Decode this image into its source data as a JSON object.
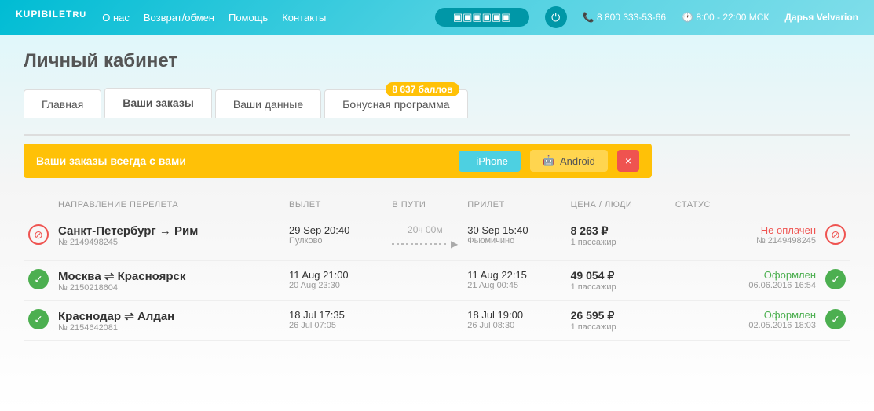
{
  "header": {
    "logo": "KUPIBILET",
    "logo_ru": "RU",
    "nav": [
      "О нас",
      "Возврат/обмен",
      "Помощь",
      "Контакты"
    ],
    "search_placeholder": "Поиск",
    "phone": "8 800 333-53-66",
    "hours": "8:00 - 22:00 МСК",
    "user": "Дарья Velvarion"
  },
  "page": {
    "title": "Личный кабинет"
  },
  "tabs": [
    {
      "label": "Главная",
      "active": false
    },
    {
      "label": "Ваши заказы",
      "active": true
    },
    {
      "label": "Ваши данные",
      "active": false
    },
    {
      "label": "Бонусная программа",
      "active": false
    }
  ],
  "bonus_badge": "8 637  баллов",
  "app_banner": {
    "text": "Ваши заказы всегда с вами",
    "iphone_label": "iPhone",
    "android_label": "Android",
    "close": "×"
  },
  "table": {
    "headers": [
      "НАПРАВЛЕНИЕ ПЕРЕЛЕТА",
      "ВЫЛЕТ",
      "В ПУТИ",
      "ПРИЛЕТ",
      "ЦЕНА / ЛЮДИ",
      "СТАТУС"
    ],
    "rows": [
      {
        "status_icon": "red",
        "route": "Санкт-Петербург → Рим",
        "order_num": "№ 2149498245",
        "depart_date": "29 Sep 20:40",
        "depart_airport": "Пулково",
        "duration": "20ч 00м",
        "arrive_date": "30 Sep 15:40",
        "arrive_airport": "Фьюмичино",
        "price": "8 263 ₽",
        "passengers": "1 пассажир",
        "status_text": "Не оплачен",
        "status_color": "red",
        "status_order": "№ 2149498245",
        "status_date": ""
      },
      {
        "status_icon": "green",
        "route": "Москва ⇌ Красноярск",
        "order_num": "№ 2150218604",
        "depart_date": "11 Aug 21:00",
        "depart_date2": "20 Aug 23:30",
        "depart_airport": "",
        "duration": "",
        "arrive_date": "11 Aug 22:15",
        "arrive_date2": "21 Aug 00:45",
        "arrive_airport": "",
        "price": "49 054 ₽",
        "passengers": "1 пассажир",
        "status_text": "Оформлен",
        "status_color": "green",
        "status_order": "",
        "status_date": "06.06.2016 16:54"
      },
      {
        "status_icon": "green",
        "route": "Краснодар ⇌ Алдан",
        "order_num": "№ 2154642081",
        "depart_date": "18 Jul 17:35",
        "depart_date2": "26 Jul 07:05",
        "depart_airport": "",
        "duration": "",
        "arrive_date": "18 Jul 19:00",
        "arrive_date2": "26 Jul 08:30",
        "arrive_airport": "",
        "price": "26 595 ₽",
        "passengers": "1 пассажир",
        "status_text": "Оформлен",
        "status_color": "green",
        "status_order": "",
        "status_date": "02.05.2016 18:03"
      }
    ]
  }
}
